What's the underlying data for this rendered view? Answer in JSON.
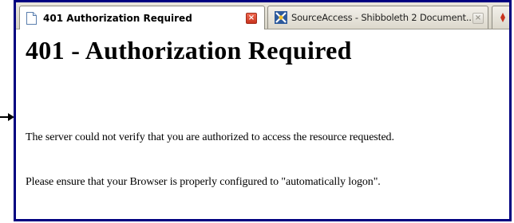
{
  "tabs": [
    {
      "label": "401 Authorization Required",
      "icon": "document-icon",
      "close_label": "×",
      "state": "active"
    },
    {
      "label": "SourceAccess - Shibboleth 2 Document...",
      "icon": "sourceaccess-logo-icon",
      "close_label": "×",
      "state": "inactive"
    }
  ],
  "page": {
    "heading": "401 - Authorization Required",
    "paragraphs": [
      "The server could not verify that you are authorized to access the resource requested.",
      "Please ensure that your Browser is properly configured to \"automatically logon\"."
    ]
  },
  "colors": {
    "frame_border": "#000080",
    "close_active": "#d8402a",
    "arrow": "#000000"
  }
}
